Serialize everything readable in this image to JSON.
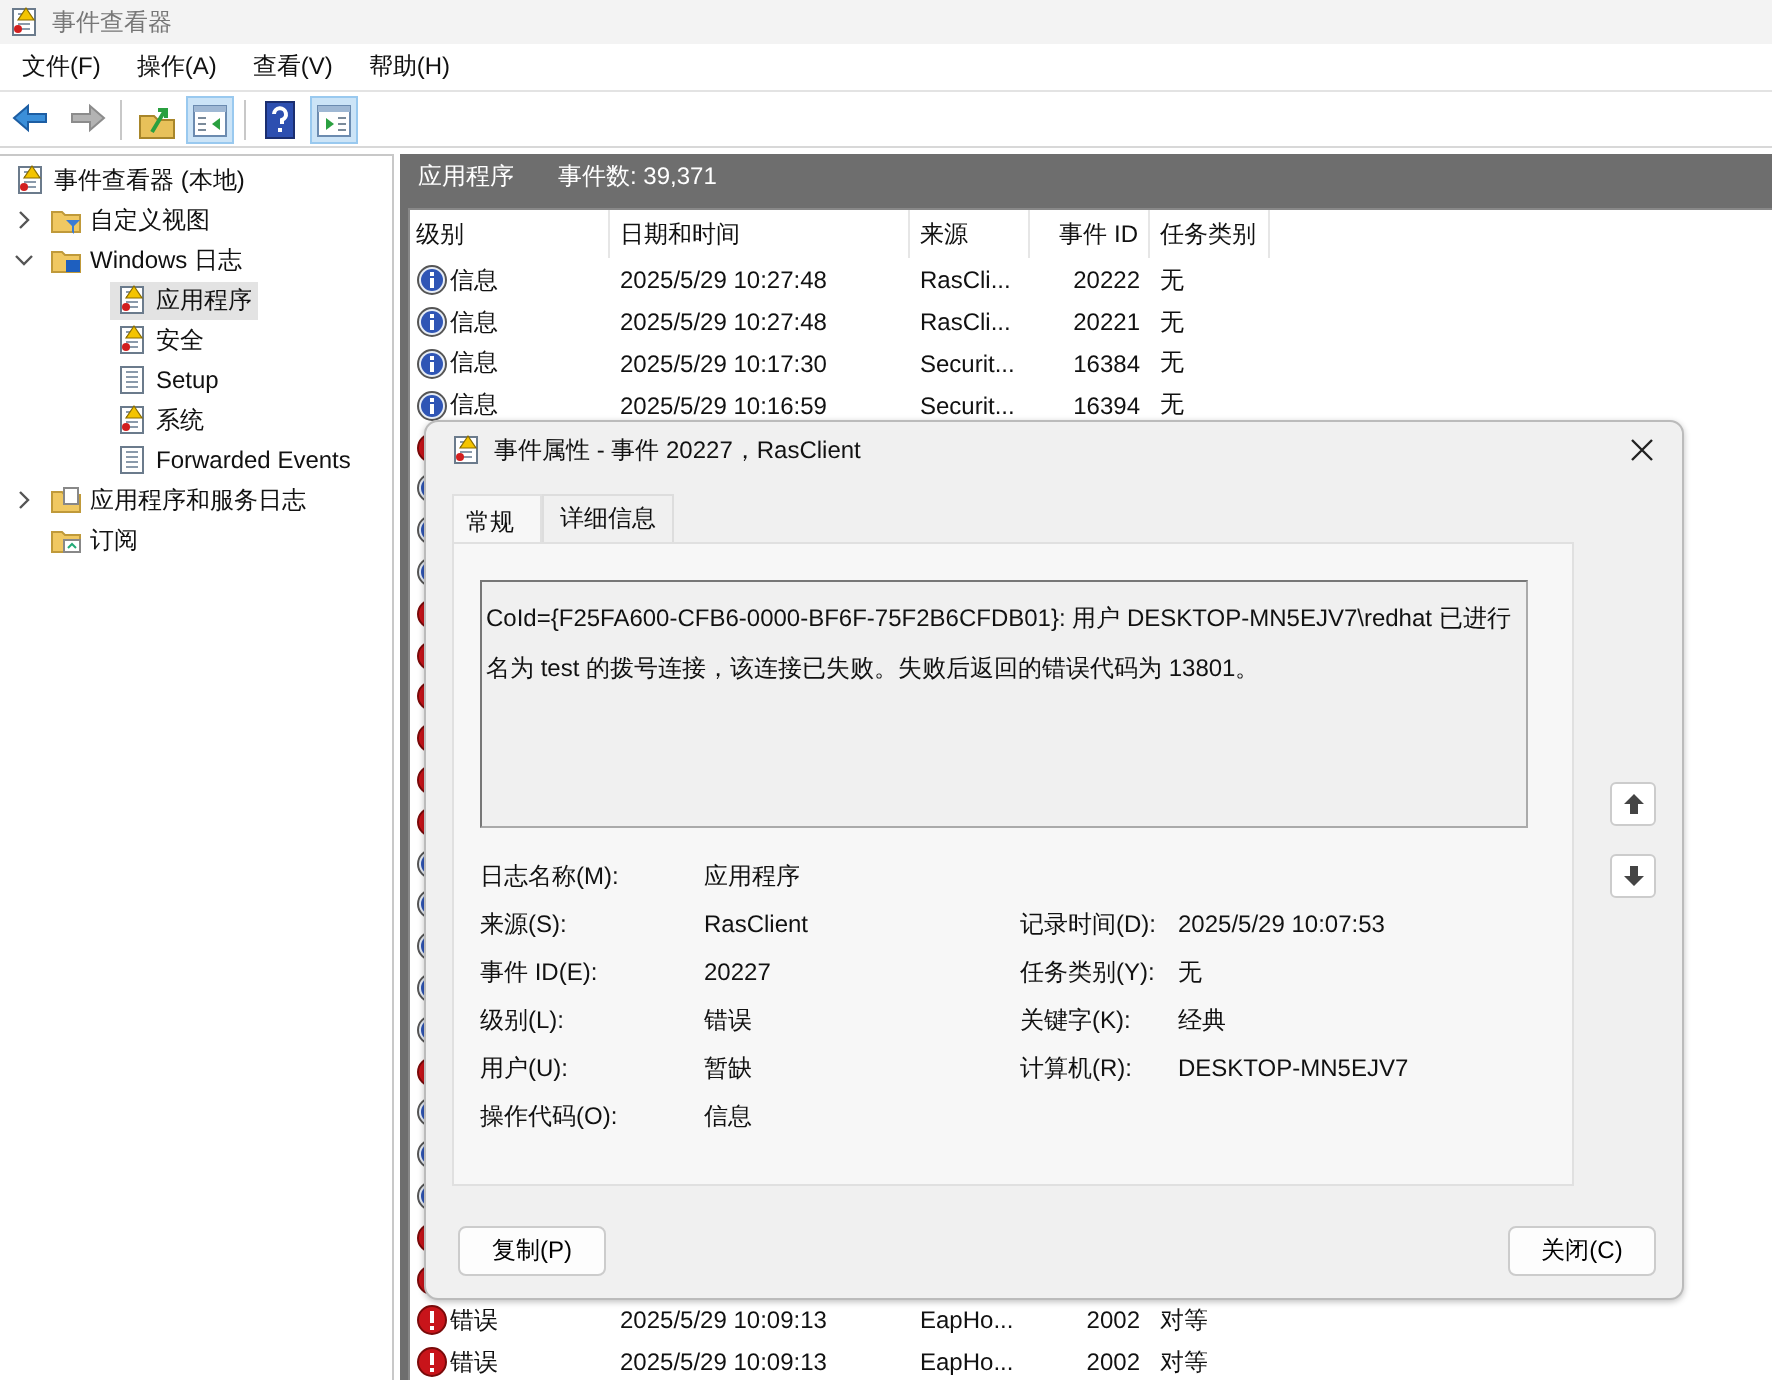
{
  "window": {
    "title": "事件查看器"
  },
  "menu": [
    "文件(F)",
    "操作(A)",
    "查看(V)",
    "帮助(H)"
  ],
  "toolbar": [
    {
      "kind": "back",
      "disabled": false
    },
    {
      "kind": "forward",
      "disabled": true
    },
    {
      "kind": "sep"
    },
    {
      "kind": "up",
      "disabled": false
    },
    {
      "kind": "pane-left",
      "disabled": false,
      "on": true
    },
    {
      "kind": "sep"
    },
    {
      "kind": "help",
      "disabled": false
    },
    {
      "kind": "pane-right",
      "disabled": false,
      "on": true
    }
  ],
  "tree": [
    {
      "label": "事件查看器 (本地)",
      "kind": "root",
      "selected": false,
      "children": [
        {
          "label": "自定义视图",
          "kind": "filter-folder",
          "expanded": false,
          "selected": false
        },
        {
          "label": "Windows 日志",
          "kind": "win-folder",
          "expanded": true,
          "selected": false,
          "children": [
            {
              "label": "应用程序",
              "kind": "log-alert",
              "selected": true
            },
            {
              "label": "安全",
              "kind": "log-alert",
              "selected": false
            },
            {
              "label": "Setup",
              "kind": "log",
              "selected": false
            },
            {
              "label": "系统",
              "kind": "log-alert",
              "selected": false
            },
            {
              "label": "Forwarded Events",
              "kind": "log",
              "selected": false
            }
          ]
        },
        {
          "label": "应用程序和服务日志",
          "kind": "folder",
          "expanded": false,
          "selected": false
        },
        {
          "label": "订阅",
          "kind": "sub-folder",
          "selected": false
        }
      ]
    }
  ],
  "log_header": {
    "name": "应用程序",
    "count": "事件数: 39,371"
  },
  "table": {
    "columns": [
      {
        "label": "级别"
      },
      {
        "label": "日期和时间"
      },
      {
        "label": "来源"
      },
      {
        "label": "事件 ID"
      },
      {
        "label": "任务类别"
      }
    ],
    "rows": [
      {
        "kind": "info",
        "cells": [
          "信息",
          "2025/5/29 10:27:48",
          "RasCli...",
          "20222",
          "无"
        ]
      },
      {
        "kind": "info",
        "cells": [
          "信息",
          "2025/5/29 10:27:48",
          "RasCli...",
          "20221",
          "无"
        ]
      },
      {
        "kind": "info",
        "cells": [
          "信息",
          "2025/5/29 10:17:30",
          "Securit...",
          "16384",
          "无"
        ]
      },
      {
        "kind": "info",
        "cells": [
          "信息",
          "2025/5/29 10:16:59",
          "Securit...",
          "16394",
          "无"
        ]
      },
      {
        "kind": "error"
      },
      {
        "kind": "info"
      },
      {
        "kind": "info"
      },
      {
        "kind": "info"
      },
      {
        "kind": "error"
      },
      {
        "kind": "error"
      },
      {
        "kind": "error"
      },
      {
        "kind": "error"
      },
      {
        "kind": "error"
      },
      {
        "kind": "error"
      },
      {
        "kind": "info"
      },
      {
        "kind": "info"
      },
      {
        "kind": "info"
      },
      {
        "kind": "info"
      },
      {
        "kind": "info"
      },
      {
        "kind": "error"
      },
      {
        "kind": "info"
      },
      {
        "kind": "info"
      },
      {
        "kind": "info"
      },
      {
        "kind": "error"
      },
      {
        "kind": "error"
      },
      {
        "kind": "error",
        "cells": [
          "错误",
          "2025/5/29 10:09:13",
          "EapHo...",
          "2002",
          "对等"
        ]
      },
      {
        "kind": "error",
        "cells": [
          "错误",
          "2025/5/29 10:09:13",
          "EapHo...",
          "2002",
          "对等"
        ]
      }
    ]
  },
  "dialog": {
    "title": "事件属性 - 事件 20227，RasClient",
    "tabs": [
      {
        "label": "常规",
        "selected": true
      },
      {
        "label": "详细信息",
        "selected": false
      }
    ],
    "message": "CoId={F25FA600-CFB6-0000-BF6F-75F2B6CFDB01}: 用户 DESKTOP-MN5EJV7\\redhat 已进行名为 test 的拨号连接，该连接已失败。失败后返回的错误代码为 13801。",
    "fields": [
      {
        "left": {
          "label": "日志名称(M):",
          "value": "应用程序"
        }
      },
      {
        "left": {
          "label": "来源(S):",
          "value": "RasClient"
        },
        "right": {
          "label": "记录时间(D):",
          "value": "2025/5/29 10:07:53"
        }
      },
      {
        "left": {
          "label": "事件 ID(E):",
          "value": "20227"
        },
        "right": {
          "label": "任务类别(Y):",
          "value": "无"
        }
      },
      {
        "left": {
          "label": "级别(L):",
          "value": "错误"
        },
        "right": {
          "label": "关键字(K):",
          "value": "经典"
        }
      },
      {
        "left": {
          "label": "用户(U):",
          "value": "暂缺"
        },
        "right": {
          "label": "计算机(R):",
          "value": "DESKTOP-MN5EJV7"
        }
      },
      {
        "left": {
          "label": "操作代码(O):",
          "value": "信息"
        }
      }
    ],
    "buttons": [
      {
        "label": "复制(P)"
      },
      {
        "label": "关闭(C)"
      }
    ]
  }
}
